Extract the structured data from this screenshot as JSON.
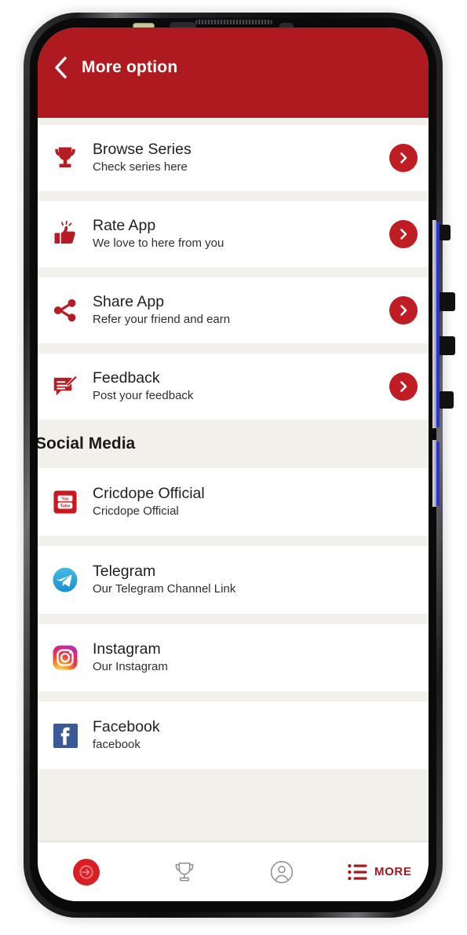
{
  "app": {
    "header": {
      "title": "More option",
      "back_icon": "chevron-left-icon",
      "background_color": "#AF1A20"
    },
    "theme": {
      "primary_red": "#AF1A20",
      "accent_red": "#C01C24",
      "nav_red": "#9E1B22",
      "page_background": "#F2F0EA",
      "card_background": "#FFFFFF"
    }
  },
  "main_options": [
    {
      "icon": "trophy-icon",
      "title": "Browse Series",
      "subtitle": "Check series here",
      "arrow_icon": "chevron-right-icon"
    },
    {
      "icon": "thumbs-up-icon",
      "title": "Rate App",
      "subtitle": "We love to here from you",
      "arrow_icon": "chevron-right-icon"
    },
    {
      "icon": "share-nodes-icon",
      "title": "Share App",
      "subtitle": "Refer your friend and earn",
      "arrow_icon": "chevron-right-icon"
    },
    {
      "icon": "feedback-edit-icon",
      "title": "Feedback",
      "subtitle": "Post your feedback",
      "arrow_icon": "chevron-right-icon"
    }
  ],
  "social_section": {
    "header": "Social Media",
    "items": [
      {
        "icon": "youtube-icon",
        "title": "Cricdope Official",
        "subtitle": "Cricdope Official"
      },
      {
        "icon": "telegram-icon",
        "title": "Telegram",
        "subtitle": "Our Telegram Channel Link"
      },
      {
        "icon": "instagram-icon",
        "title": "Instagram",
        "subtitle": "Our Instagram"
      },
      {
        "icon": "facebook-icon",
        "title": "Facebook",
        "subtitle": "facebook"
      }
    ]
  },
  "bottom_nav": {
    "items": [
      {
        "icon": "live-arrow-icon",
        "label": "",
        "active": true
      },
      {
        "icon": "trophy-outline-icon",
        "label": "",
        "active": false
      },
      {
        "icon": "account-circle-icon",
        "label": "",
        "active": false
      },
      {
        "icon": "list-menu-icon",
        "label": "MORE",
        "active": true
      }
    ]
  }
}
